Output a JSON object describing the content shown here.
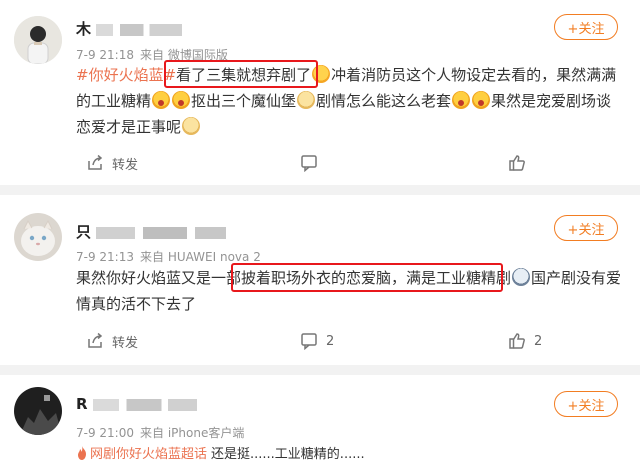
{
  "posts": [
    {
      "username": "木",
      "time": "7-9 21:18",
      "source": "来自 微博国际版",
      "follow_label": "+关注",
      "topic": "#你好火焰蓝#",
      "boxed_text": "看了三集就想弃剧了",
      "text_1": "冲着消防员这个人物设定去看的，果然满满的工业糖精",
      "text_2": "抠出三个魔仙堡",
      "text_3": "剧情怎么能这么老套",
      "text_4": "果然是宠爱剧场谈恋爱才是正事呢",
      "repost_label": "转发",
      "comment_count": "",
      "like_count": ""
    },
    {
      "username": "只",
      "time": "7-9 21:13",
      "source": "来自 HUAWEI nova 2",
      "follow_label": "+关注",
      "text_pre": "果然你好火焰蓝又是一部",
      "boxed_text": "披着职场外衣的恋爱脑，满是工业糖精剧",
      "text_post": "国产剧没有爱情真的活不下去了",
      "repost_label": "转发",
      "comment_count": "2",
      "like_count": "2"
    },
    {
      "username": "R",
      "time": "7-9 21:00",
      "source": "来自 iPhone客户端",
      "follow_label": "+关注",
      "super_topic": "网剧你好火焰蓝超话",
      "text": "还是挺......工业糖精的......"
    }
  ],
  "icons": {
    "repost": "share-icon",
    "comment": "comment-icon",
    "like": "thumbs-up-icon",
    "fire": "fire-icon"
  },
  "colors": {
    "accent": "#f27d22",
    "topic": "#eb7350",
    "highlight_box": "#e8181c",
    "separator": "#f2f2f2"
  }
}
